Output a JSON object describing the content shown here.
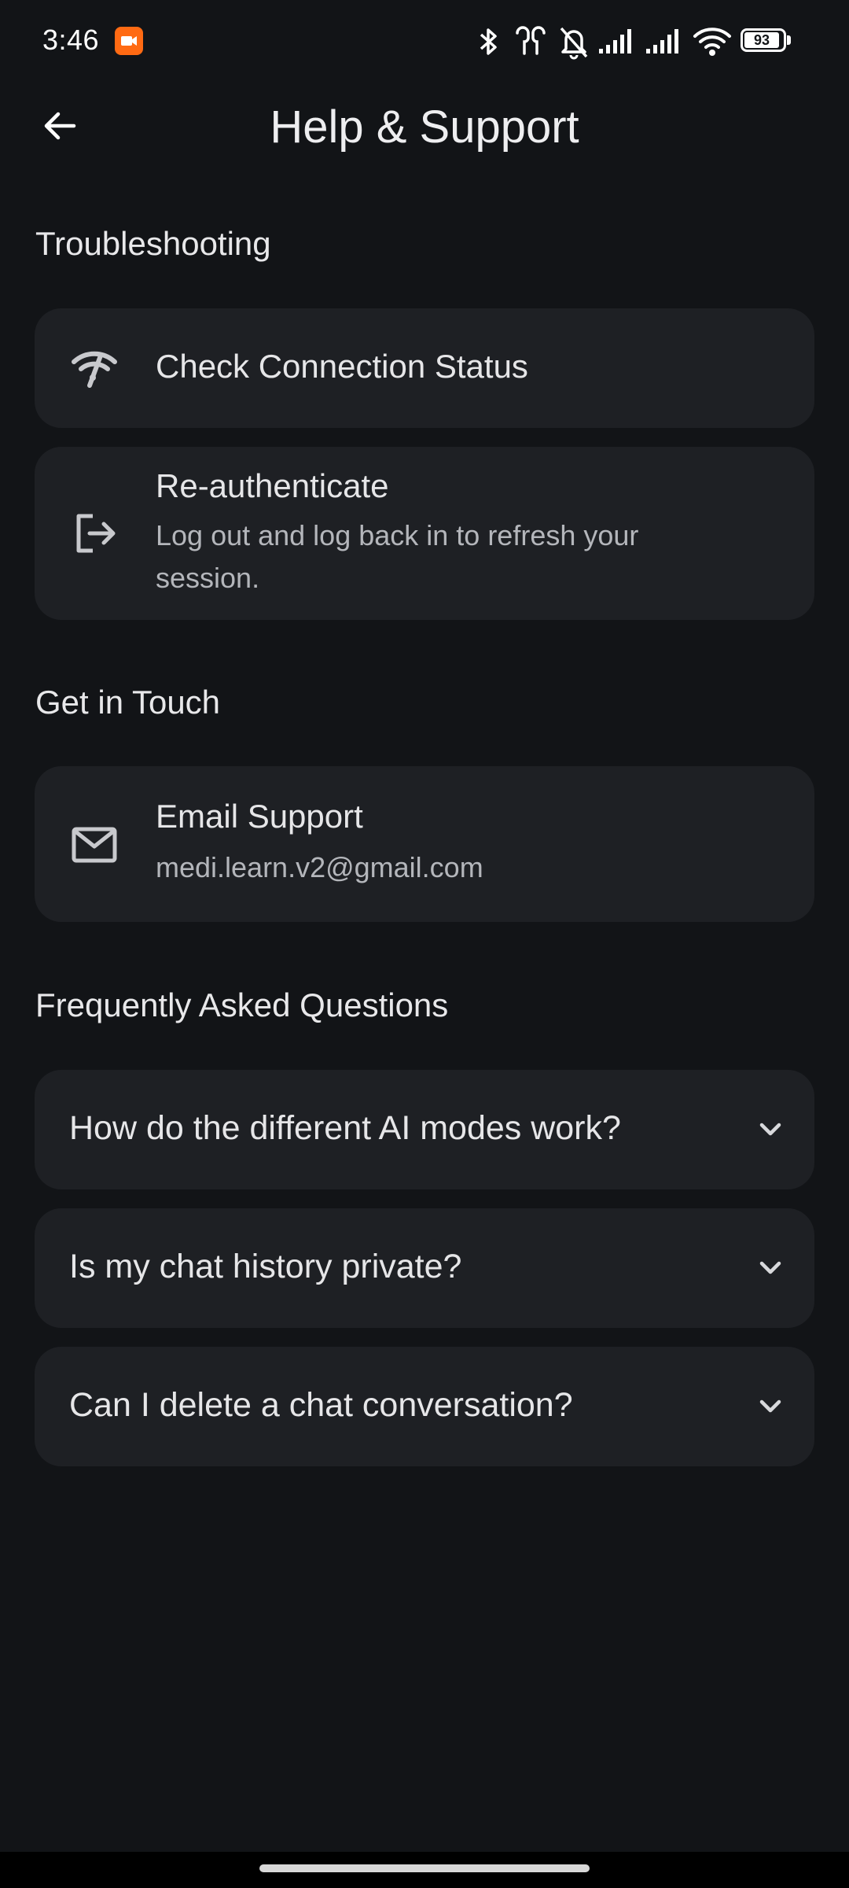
{
  "status_bar": {
    "time": "3:46",
    "battery_level": "93",
    "icons": [
      "screen-record-icon",
      "bluetooth-icon",
      "earbuds-icon",
      "bell-muted-icon",
      "signal-icon",
      "signal-icon",
      "wifi-icon",
      "battery-icon"
    ]
  },
  "app_bar": {
    "title": "Help & Support",
    "back_icon": "arrow-left-icon"
  },
  "troubleshooting": {
    "heading": "Troubleshooting",
    "items": [
      {
        "title": "Check Connection Status",
        "icon": "wifi-off-icon"
      },
      {
        "title": "Re-authenticate",
        "subtitle_line1": "Log out and log back in to refresh your",
        "subtitle_line2": "session.",
        "icon": "logout-icon"
      }
    ]
  },
  "contact": {
    "heading": "Get in Touch",
    "email_title": "Email Support",
    "email_address": "medi.learn.v2@gmail.com",
    "icon": "mail-icon"
  },
  "faq": {
    "heading": "Frequently Asked Questions",
    "items": [
      {
        "question": "How do the different AI modes work?"
      },
      {
        "question": "Is my chat history private?"
      },
      {
        "question": "Can I delete a chat conversation?"
      }
    ]
  },
  "colors": {
    "background": "#121417",
    "card": "#1e2024",
    "text": "#e6e6e8",
    "subtext": "#b4b6bb"
  }
}
